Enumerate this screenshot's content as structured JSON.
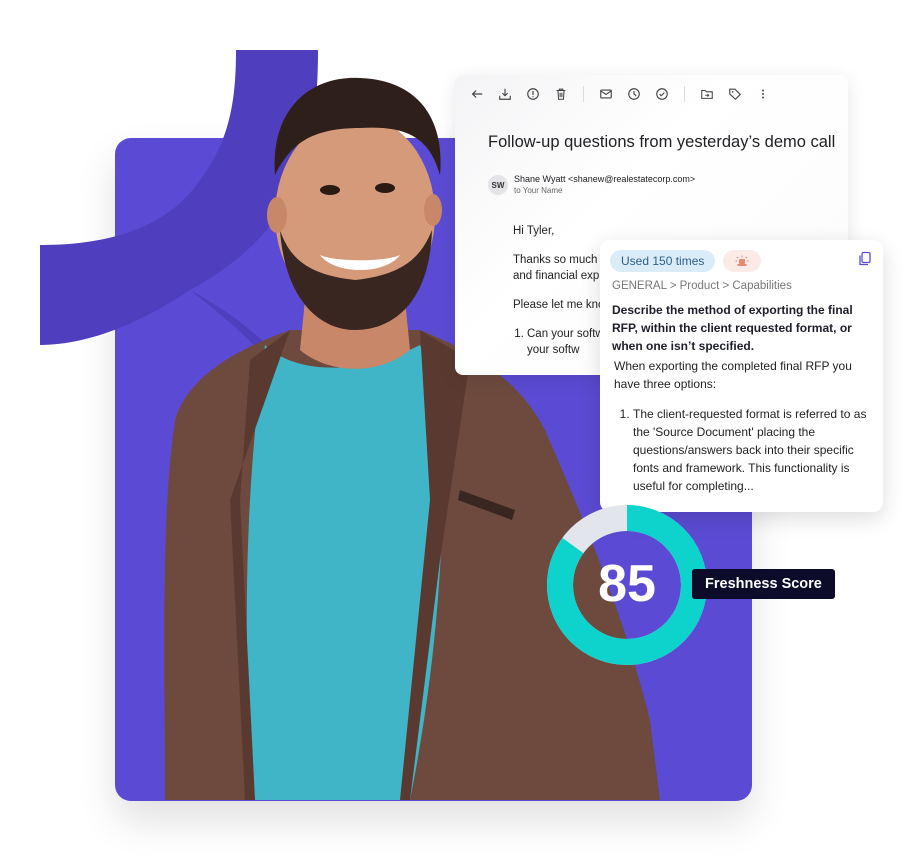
{
  "email": {
    "toolbar": [
      {
        "icon": "back-arrow-icon",
        "label": "Back"
      },
      {
        "icon": "archive-icon",
        "label": "Archive"
      },
      {
        "icon": "report-spam-icon",
        "label": "Report spam"
      },
      {
        "icon": "delete-icon",
        "label": "Delete"
      },
      {
        "icon": "mark-unread-icon",
        "label": "Mark as unread"
      },
      {
        "icon": "snooze-icon",
        "label": "Snooze"
      },
      {
        "icon": "add-to-tasks-icon",
        "label": "Add to tasks"
      },
      {
        "icon": "move-to-icon",
        "label": "Move to"
      },
      {
        "icon": "label-icon",
        "label": "Labels"
      },
      {
        "icon": "more-icon",
        "label": "More"
      }
    ],
    "subject": "Follow-up questions from yesterday’s demo call",
    "sender": {
      "initials": "SW",
      "name_line": "Shane Wyatt <shanew@realestatecorp.com>",
      "to_line": "to Your Name"
    },
    "body": {
      "greeting": "Hi Tyler,",
      "para1_line1": "Thanks so much",
      "para1_line2": "and financial exp",
      "para2": "Please let me kno",
      "list_item1_line1": "Can your softw",
      "list_item1_line2": "your softw"
    }
  },
  "answer_card": {
    "usage_badge": "Used 150 times",
    "alert_badge_icon": "siren-icon",
    "copy_icon": "copy-icon",
    "breadcrumb": "GENERAL > Product > Capabilities",
    "question": "Describe the method of exporting the final RFP, within the client requested format, or when one isn’t specified.",
    "answer_intro": "When exporting the completed final RFP you have three options:",
    "answer_items": [
      "The client-requested format is referred to as the 'Source Document' placing the questions/answers back into their specific fonts and framework. This functionality is useful for completing..."
    ]
  },
  "freshness": {
    "score": 85,
    "score_text": "85",
    "max": 100,
    "label": "Freshness Score",
    "color_filled": "#0dd3cc",
    "color_remaining": "#e2e6ec"
  },
  "colors": {
    "brand_purple": "#5b4bd4",
    "brand_purple_dark": "#4f3ebd"
  }
}
